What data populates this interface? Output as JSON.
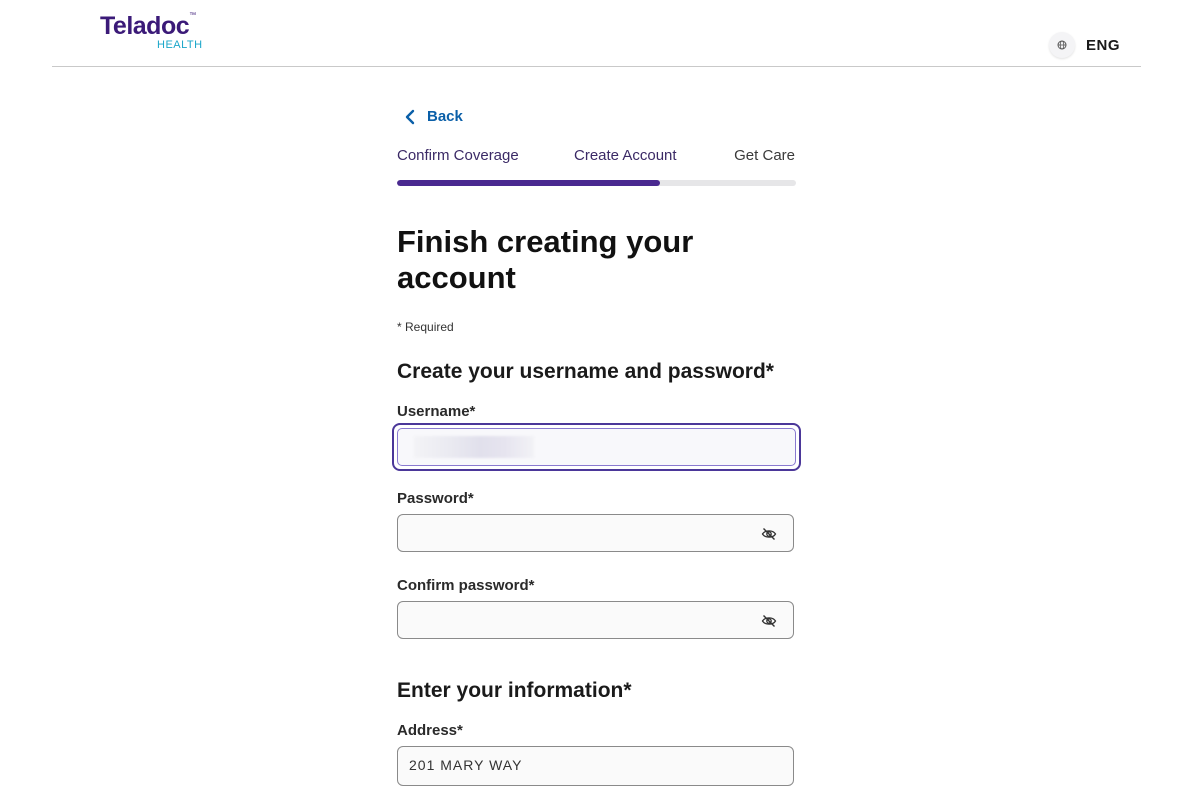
{
  "header": {
    "logo_main": "Teladoc",
    "logo_tm": "™",
    "logo_sub": "HEALTH",
    "language": "ENG",
    "language_icon": "globe-icon"
  },
  "nav": {
    "back_label": "Back",
    "back_icon": "chevron-left-icon"
  },
  "steps": {
    "items": [
      "Confirm Coverage",
      "Create Account",
      "Get Care"
    ],
    "progress_percent": 66
  },
  "page": {
    "title": "Finish creating your account",
    "required_note": "* Required"
  },
  "credentials": {
    "section_title": "Create your username and password*",
    "username_label": "Username*",
    "password_label": "Password*",
    "confirm_label": "Confirm password*",
    "visibility_icon": "eye-off-icon"
  },
  "info": {
    "section_title": "Enter your information*",
    "address_label": "Address*",
    "address_value": "201 MARY WAY"
  },
  "colors": {
    "brand_purple": "#3b1a78",
    "brand_teal": "#1aa6c9",
    "link_blue": "#0a5fa8",
    "progress_fill": "#4a2990",
    "focus_ring": "#4b3799"
  }
}
